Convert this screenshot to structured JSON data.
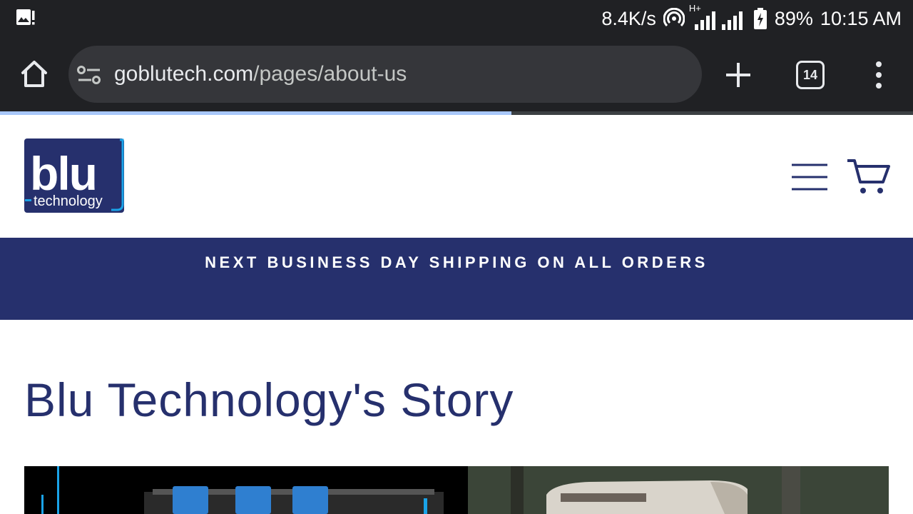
{
  "status_bar": {
    "net_speed": "8.4K/s",
    "network_type": "H+",
    "battery": "89%",
    "time": "10:15 AM",
    "icons": [
      "gallery-alert-icon",
      "hotspot-icon",
      "signal-icon",
      "signal-icon",
      "battery-charging-icon"
    ]
  },
  "browser": {
    "url_domain": "goblutech.com",
    "url_path": "/pages/about-us",
    "tab_count": "14",
    "load_progress": 0.56,
    "icons": [
      "home-icon",
      "site-settings-icon",
      "plus-icon",
      "more-vert-icon"
    ]
  },
  "site": {
    "logo_main": "blu",
    "logo_sub": "technology",
    "announcement": "NEXT BUSINESS DAY SHIPPING ON ALL ORDERS",
    "icons": [
      "hamburger-menu-icon",
      "cart-icon"
    ]
  },
  "page": {
    "title": "Blu Technology's Story"
  },
  "colors": {
    "brand_navy": "#26306d",
    "brand_blue": "#1aa3e8",
    "browser_dark": "#202124",
    "progress": "#a8c7fa"
  }
}
